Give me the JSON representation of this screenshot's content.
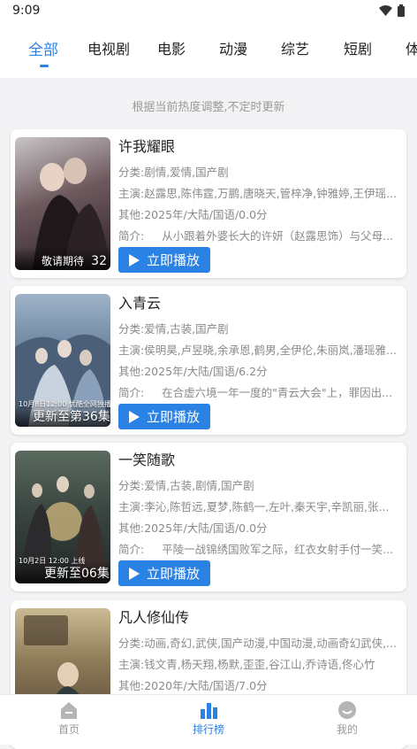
{
  "status": {
    "time": "9:09"
  },
  "tabs": [
    "全部",
    "电视剧",
    "电影",
    "动漫",
    "综艺",
    "短剧",
    "体"
  ],
  "notice": "根据当前热度调整,不定时更新",
  "play_label": "立即播放",
  "items": [
    {
      "title": "许我耀眼",
      "category": "分类:剧情,爱情,国产剧",
      "cast": "主演:赵露思,陈伟霆,万鹏,唐晓天,管梓净,钟雅婷,王伊瑶...",
      "other": "其他:2025年/大陆/国语/0.0分",
      "intro_label": "简介:",
      "intro": "从小跟着外婆长大的许妍（赵露思饰）与父母...",
      "poster_text": "敬请期待",
      "poster_badge": "32",
      "poster_sub": ""
    },
    {
      "title": "入青云",
      "category": "分类:爱情,古装,国产剧",
      "cast": "主演:侯明昊,卢昱晓,余承恩,鹤男,全伊伦,朱丽岚,潘瑶雅...",
      "other": "其他:2025年/大陆/国语/6.2分",
      "intro_label": "简介:",
      "intro": "在合虚六境一年一度的\"青云大会\"上，罪因出...",
      "poster_text": "更新至第36集",
      "poster_badge": "",
      "poster_sub": "10月8日12:00 优酷全网独播"
    },
    {
      "title": "一笑随歌",
      "category": "分类:爱情,古装,剧情,国产剧",
      "cast": "主演:李沁,陈哲远,夏梦,陈鹤一,左叶,秦天宇,辛凯丽,张...",
      "other": "其他:2025年/大陆/国语/0.0分",
      "intro_label": "简介:",
      "intro": "平陵一战锦绣国败军之际，红衣女射手付一笑...",
      "poster_text": "更新至06集",
      "poster_badge": "",
      "poster_sub": "10月2日 12:00 上线"
    },
    {
      "title": "凡人修仙传",
      "category": "分类:动画,奇幻,武侠,国产动漫,中国动漫,动画奇幻武侠,...",
      "cast": "主演:钱文青,杨天翔,杨默,歪歪,谷江山,乔诗语,佟心竹",
      "other": "其他:2020年/大陆/国语/7.0分",
      "intro_label": "",
      "intro": "",
      "poster_text": "",
      "poster_badge": "",
      "poster_sub": ""
    }
  ],
  "nav": [
    {
      "label": "首页",
      "icon": "home-icon"
    },
    {
      "label": "排行榜",
      "icon": "ranking-icon"
    },
    {
      "label": "我的",
      "icon": "profile-icon"
    }
  ],
  "colors": {
    "accent": "#2a82e4",
    "background": "#f3f3f5"
  }
}
